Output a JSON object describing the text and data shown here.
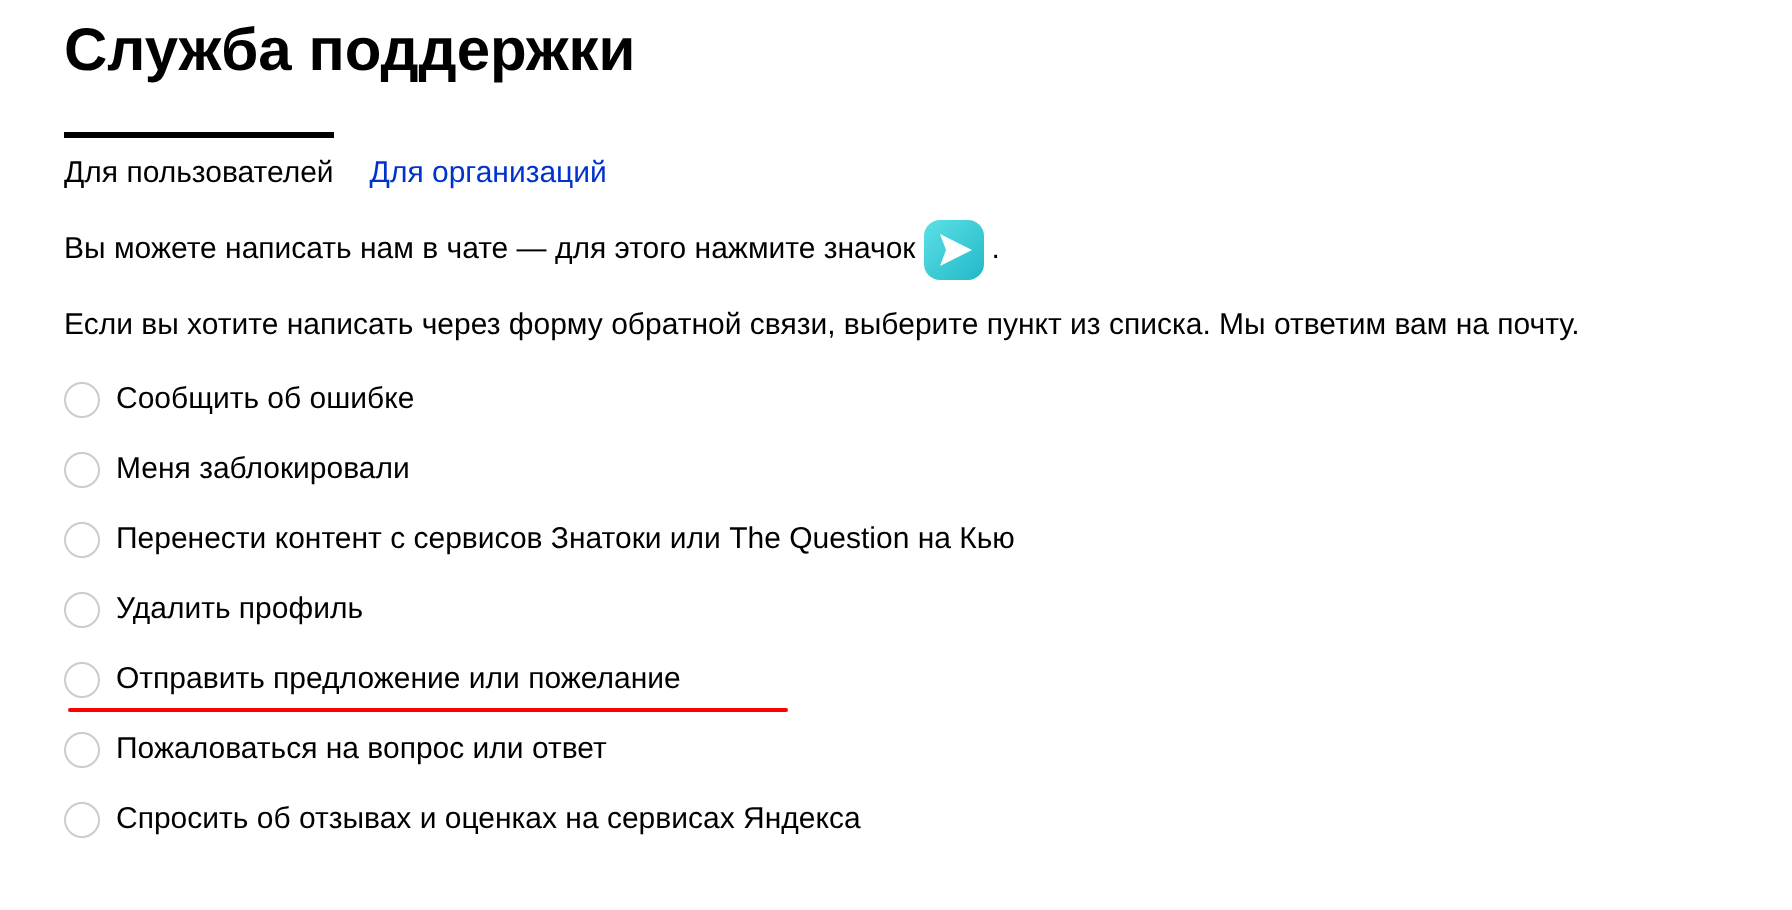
{
  "title": "Служба поддержки",
  "tabs": [
    {
      "label": "Для пользователей",
      "selected": true
    },
    {
      "label": "Для организаций",
      "selected": false
    }
  ],
  "chat_note": {
    "text": "Вы можете написать нам в чате — для этого нажмите значок",
    "end": "."
  },
  "form_note": "Если вы хотите написать через форму обратной связи, выберите пункт из списка. Мы ответим вам на почту.",
  "options": [
    {
      "label": "Сообщить об ошибке",
      "selected": false,
      "underlined": false
    },
    {
      "label": "Меня заблокировали",
      "selected": false,
      "underlined": false
    },
    {
      "label": "Перенести контент с сервисов Знатоки или The Question на Кью",
      "selected": false,
      "underlined": false
    },
    {
      "label": "Удалить профиль",
      "selected": false,
      "underlined": false
    },
    {
      "label": "Отправить предложение или пожелание",
      "selected": false,
      "underlined": true
    },
    {
      "label": "Пожаловаться на вопрос или ответ",
      "selected": false,
      "underlined": false
    },
    {
      "label": "Спросить об отзывах и оценках на сервисах Яндекса",
      "selected": false,
      "underlined": false
    }
  ]
}
